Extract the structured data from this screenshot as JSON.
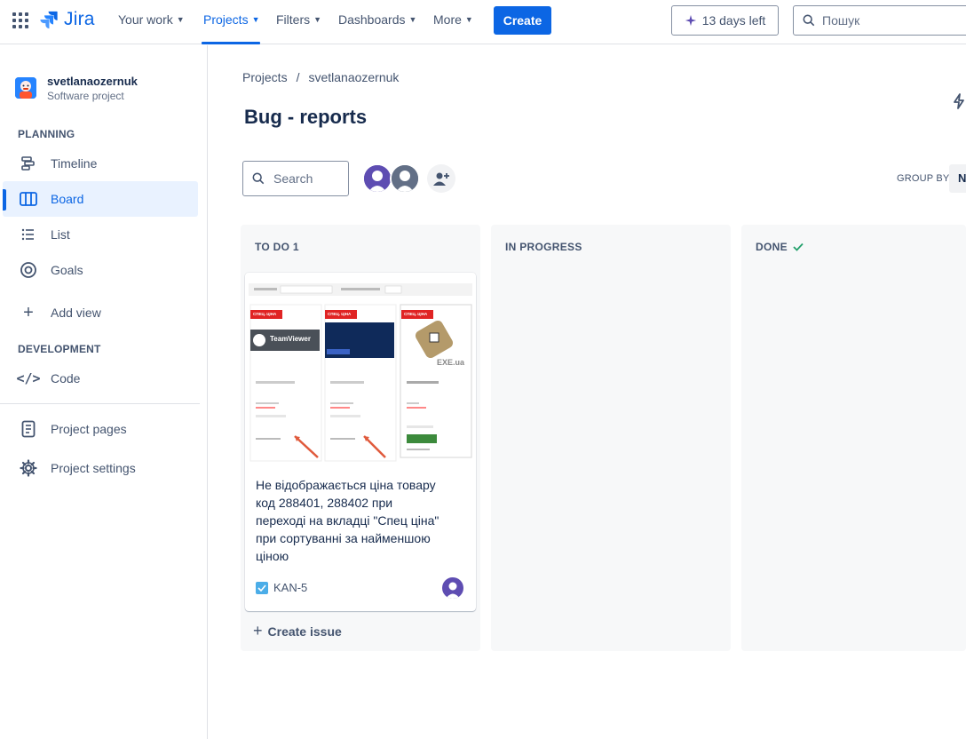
{
  "topnav": {
    "logo": "Jira",
    "items": [
      {
        "label": "Your work"
      },
      {
        "label": "Projects"
      },
      {
        "label": "Filters"
      },
      {
        "label": "Dashboards"
      },
      {
        "label": "More"
      }
    ],
    "create_label": "Create",
    "trial_label": "13 days left",
    "search_placeholder": "Пошук"
  },
  "sidebar": {
    "project_name": "svetlanaozernuk",
    "project_type": "Software project",
    "planning_heading": "PLANNING",
    "planning_items": [
      {
        "label": "Timeline",
        "icon": "timeline-icon"
      },
      {
        "label": "Board",
        "icon": "board-icon",
        "active": true
      },
      {
        "label": "List",
        "icon": "list-icon"
      },
      {
        "label": "Goals",
        "icon": "goals-icon"
      }
    ],
    "add_view_label": "Add view",
    "development_heading": "DEVELOPMENT",
    "code_label": "Code",
    "project_pages_label": "Project pages",
    "project_settings_label": "Project settings"
  },
  "main": {
    "breadcrumb": [
      "Projects",
      "/",
      "svetlanaozernuk"
    ],
    "title": "Bug - reports",
    "search_placeholder": "Search",
    "group_by_label": "GROUP BY",
    "group_by_value": "N"
  },
  "columns": [
    {
      "title": "TO DO 1"
    },
    {
      "title": "IN PROGRESS"
    },
    {
      "title": "DONE"
    }
  ],
  "card": {
    "summary": "Не відображається ціна товару код 288401, 288402 при переході на вкладці \"Спец ціна\" при сортуванні за найменшою ціною",
    "key": "KAN-5",
    "image_badges": [
      "СПЕЦ. ЦІНА",
      "СПЕЦ. ЦІНА",
      "СПЕЦ. ЦІНА"
    ],
    "image_brands": [
      "TeamViewer",
      "EXE.ua"
    ]
  },
  "create_issue_label": "Create issue",
  "colors": {
    "accent": "#0c66e4",
    "active_bg": "#e9f2ff",
    "column_bg": "#f7f8f9",
    "done_check": "#22a06b",
    "avatar_purple": "#5e4db2"
  }
}
